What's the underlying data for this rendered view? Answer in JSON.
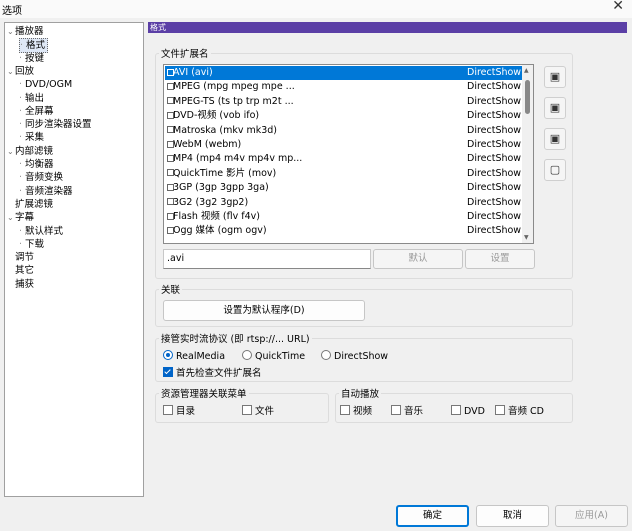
{
  "window": {
    "title": "选项",
    "close_glyph": "✕"
  },
  "tree": [
    {
      "label": "播放器",
      "level": 0,
      "expander": "⌄"
    },
    {
      "label": "格式",
      "level": 1,
      "selected": true
    },
    {
      "label": "按键",
      "level": 1
    },
    {
      "label": "回放",
      "level": 0,
      "expander": "⌄"
    },
    {
      "label": "DVD/OGM",
      "level": 1
    },
    {
      "label": "输出",
      "level": 1
    },
    {
      "label": "全屏幕",
      "level": 1
    },
    {
      "label": "同步渲染器设置",
      "level": 1
    },
    {
      "label": "采集",
      "level": 1
    },
    {
      "label": "内部滤镜",
      "level": 0,
      "expander": "⌄"
    },
    {
      "label": "均衡器",
      "level": 1
    },
    {
      "label": "音频变换",
      "level": 1
    },
    {
      "label": "音频渲染器",
      "level": 1
    },
    {
      "label": "扩展滤镜",
      "level": 0
    },
    {
      "label": "字幕",
      "level": 0,
      "expander": "⌄"
    },
    {
      "label": "默认样式",
      "level": 1
    },
    {
      "label": "下载",
      "level": 1
    },
    {
      "label": "调节",
      "level": 0
    },
    {
      "label": "其它",
      "level": 0
    },
    {
      "label": "捕获",
      "level": 0
    }
  ],
  "panel": {
    "header": "格式",
    "accent_color": "#5b3fa6"
  },
  "extensions": {
    "group_label": "文件扩展名",
    "rows": [
      {
        "name": "AVI (avi)",
        "type": "DirectShow",
        "selected": true
      },
      {
        "name": "MPEG (mpg mpeg mpe ...",
        "type": "DirectShow"
      },
      {
        "name": "MPEG-TS (ts tp trp m2t ...",
        "type": "DirectShow"
      },
      {
        "name": "DVD-视频 (vob ifo)",
        "type": "DirectShow"
      },
      {
        "name": "Matroska (mkv mk3d)",
        "type": "DirectShow"
      },
      {
        "name": "WebM (webm)",
        "type": "DirectShow"
      },
      {
        "name": "MP4 (mp4 m4v mp4v mp...",
        "type": "DirectShow"
      },
      {
        "name": "QuickTime 影片 (mov)",
        "type": "DirectShow"
      },
      {
        "name": "3GP (3gp 3gpp 3ga)",
        "type": "DirectShow"
      },
      {
        "name": "3G2 (3g2 3gp2)",
        "type": "DirectShow"
      },
      {
        "name": "Flash 视频 (flv f4v)",
        "type": "DirectShow"
      },
      {
        "name": "Ogg 媒体 (ogm ogv)",
        "type": "DirectShow"
      }
    ],
    "selection_color": "#0078d7",
    "ext_value": ".avi",
    "default_button": "默认",
    "set_button": "设置",
    "side_buttons": [
      {
        "icon": "video-file-icon",
        "glyph": "▣"
      },
      {
        "icon": "audio-file-icon",
        "glyph": "▣"
      },
      {
        "icon": "all-files-icon",
        "glyph": "▣"
      },
      {
        "icon": "clear-icon",
        "glyph": "▢"
      }
    ]
  },
  "association": {
    "label": "关联",
    "set_default_button": "设置为默认程序(D)"
  },
  "streaming": {
    "label": "接管实时流协议 (即 rtsp://... URL)",
    "options": [
      {
        "label": "RealMedia",
        "checked": true
      },
      {
        "label": "QuickTime",
        "checked": false
      },
      {
        "label": "DirectShow",
        "checked": false
      }
    ],
    "check_ext": {
      "label": "首先检查文件扩展名",
      "checked": true
    }
  },
  "explorer": {
    "label": "资源管理器关联菜单",
    "options": [
      {
        "label": "目录",
        "checked": false
      },
      {
        "label": "文件",
        "checked": false
      }
    ]
  },
  "autoplay": {
    "label": "自动播放",
    "options": [
      {
        "label": "视频",
        "checked": false
      },
      {
        "label": "音乐",
        "checked": false
      },
      {
        "label": "DVD",
        "checked": false
      },
      {
        "label": "音频 CD",
        "checked": false
      }
    ]
  },
  "footer": {
    "ok": "确定",
    "cancel": "取消",
    "apply": "应用(A)"
  }
}
